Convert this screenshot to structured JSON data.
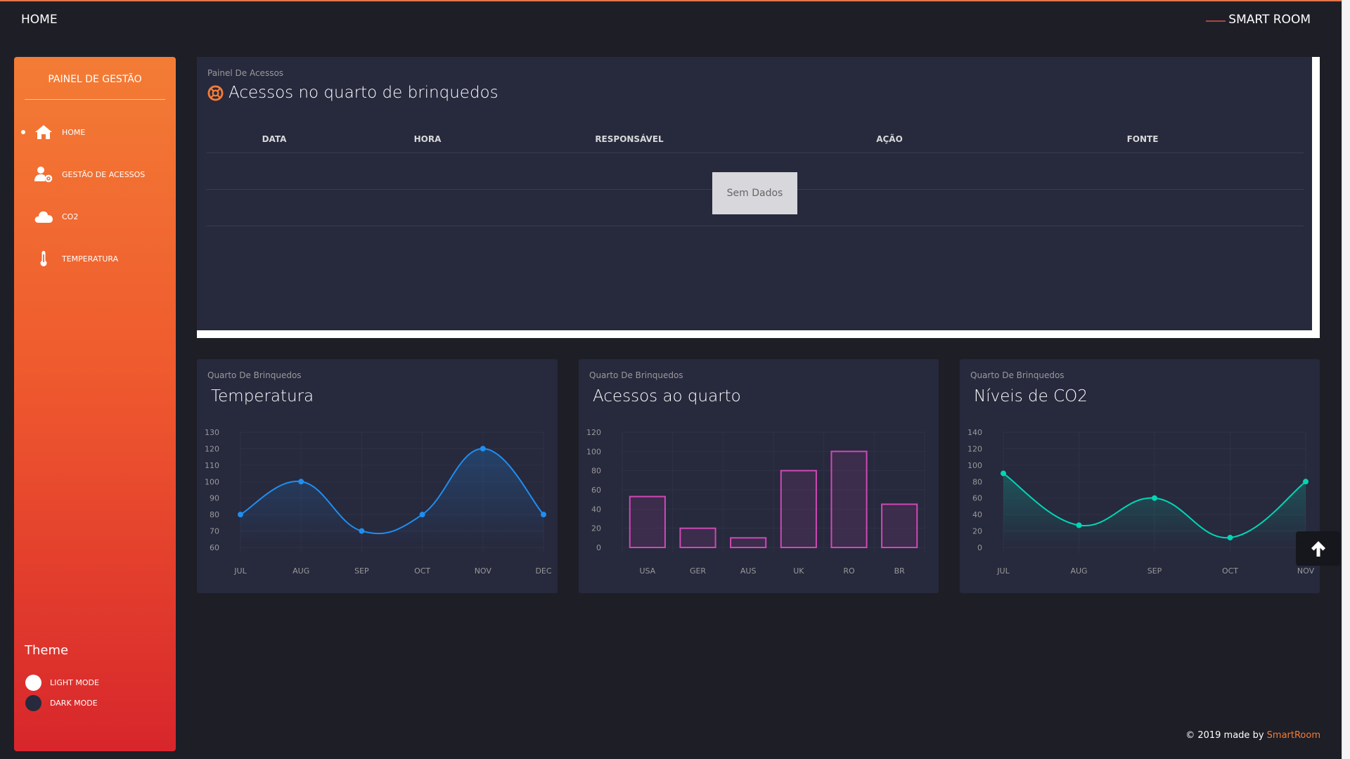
{
  "navbar": {
    "title": "HOME",
    "brand": "SMART ROOM"
  },
  "sidebar": {
    "title": "PAINEL DE GESTÃO",
    "items": [
      {
        "label": "HOME",
        "icon": "home-icon",
        "active": true
      },
      {
        "label": "GESTÃO DE ACESSOS",
        "icon": "user-gear-icon",
        "active": false
      },
      {
        "label": "CO2",
        "icon": "cloud-icon",
        "active": false
      },
      {
        "label": "TEMPERATURA",
        "icon": "thermometer-icon",
        "active": false
      }
    ],
    "theme": {
      "title": "Theme",
      "light": "LIGHT MODE",
      "dark": "DARK MODE"
    }
  },
  "access_table": {
    "subtitle": "Painel De Acessos",
    "title": "Acessos no quarto de brinquedos",
    "icon": "support-icon",
    "columns": [
      "DATA",
      "HORA",
      "RESPONSÁVEL",
      "AÇÃO",
      "FONTE"
    ],
    "empty_label": "Sem Dados"
  },
  "cards": [
    {
      "subtitle": "Quarto De Brinquedos",
      "title": "Temperatura"
    },
    {
      "subtitle": "Quarto De Brinquedos",
      "title": "Acessos ao quarto"
    },
    {
      "subtitle": "Quarto De Brinquedos",
      "title": "Níveis de CO2"
    }
  ],
  "chart_data": [
    {
      "type": "line",
      "categories": [
        "JUL",
        "AUG",
        "SEP",
        "OCT",
        "NOV",
        "DEC"
      ],
      "series": [
        {
          "values": [
            80,
            100,
            70,
            80,
            120,
            80
          ]
        }
      ],
      "yticks": [
        60,
        70,
        80,
        90,
        100,
        110,
        120,
        130
      ],
      "ylim": [
        60,
        130
      ],
      "color": "#1f8ef1",
      "smooth": true,
      "fill": true,
      "grid": true
    },
    {
      "type": "bar",
      "categories": [
        "USA",
        "GER",
        "AUS",
        "UK",
        "RO",
        "BR"
      ],
      "series": [
        {
          "values": [
            53,
            20,
            10,
            80,
            100,
            45
          ]
        }
      ],
      "yticks": [
        0,
        20,
        40,
        60,
        80,
        100,
        120
      ],
      "ylim": [
        0,
        120
      ],
      "color": "#d048b6",
      "grid": true
    },
    {
      "type": "line",
      "categories": [
        "JUL",
        "AUG",
        "SEP",
        "OCT",
        "NOV"
      ],
      "series": [
        {
          "values": [
            90,
            27,
            60,
            12,
            80
          ]
        }
      ],
      "yticks": [
        0,
        20,
        40,
        60,
        80,
        100,
        120,
        140
      ],
      "ylim": [
        0,
        140
      ],
      "color": "#00d6b4",
      "smooth": true,
      "fill": true,
      "grid": true
    }
  ],
  "footer": {
    "text": "© 2019 made by",
    "link": "SmartRoom"
  },
  "colors": {
    "accent": "#f37c35",
    "background": "#1e1e27",
    "card": "#27293d"
  }
}
